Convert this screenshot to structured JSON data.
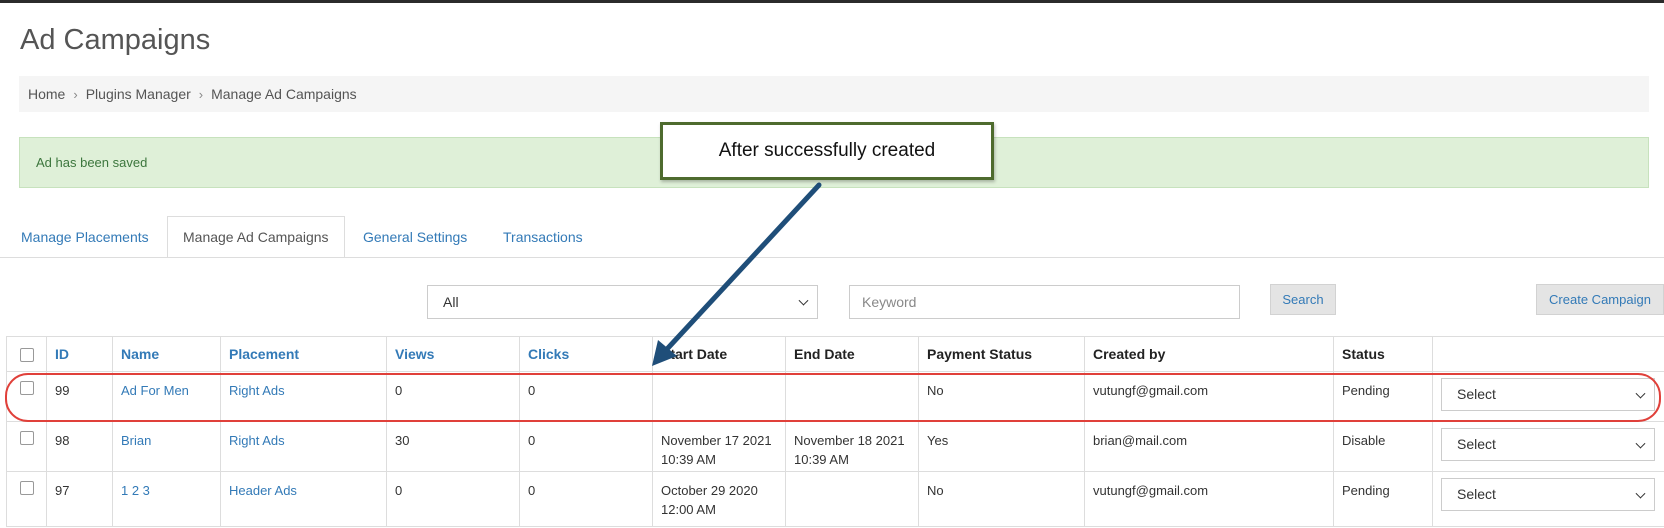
{
  "page": {
    "title": "Ad Campaigns"
  },
  "breadcrumb": {
    "items": [
      "Home",
      "Plugins Manager",
      "Manage Ad Campaigns"
    ],
    "separator": "›"
  },
  "alert": {
    "message": "Ad has been saved"
  },
  "tabs": [
    "Manage Placements",
    "Manage Ad Campaigns",
    "General Settings",
    "Transactions"
  ],
  "active_tab": "Manage Ad Campaigns",
  "filters": {
    "type_value": "All",
    "keyword_placeholder": "Keyword",
    "search_label": "Search",
    "create_label": "Create Campaign"
  },
  "table": {
    "headers": [
      "ID",
      "Name",
      "Placement",
      "Views",
      "Clicks",
      "Start Date",
      "End Date",
      "Payment Status",
      "Created by",
      "Status",
      ""
    ],
    "rows": [
      {
        "id": "99",
        "name": "Ad For Men",
        "placement": "Right Ads",
        "views": "0",
        "clicks": "0",
        "start_date": "",
        "start_time": "",
        "end_date": "",
        "end_time": "",
        "payment": "No",
        "created_by": "vutungf@gmail.com",
        "status": "Pending",
        "action": "Select"
      },
      {
        "id": "98",
        "name": "Brian",
        "placement": "Right Ads",
        "views": "30",
        "clicks": "0",
        "start_date": "November 17 2021",
        "start_time": "10:39 AM",
        "end_date": "November 18 2021",
        "end_time": "10:39 AM",
        "payment": "Yes",
        "created_by": "brian@mail.com",
        "status": "Disable",
        "action": "Select"
      },
      {
        "id": "97",
        "name": "1 2 3",
        "placement": "Header Ads",
        "views": "0",
        "clicks": "0",
        "start_date": "October 29 2020",
        "start_time": "12:00 AM",
        "end_date": "",
        "end_time": "",
        "payment": "No",
        "created_by": "vutungf@gmail.com",
        "status": "Pending",
        "action": "Select"
      }
    ]
  },
  "annotation": {
    "callout_text": "After successfully created",
    "arrow_color": "#1f4e79",
    "highlight_color": "#e0403a",
    "callout_border": "#4e6b2e"
  },
  "colors": {
    "link": "#337ab7",
    "alert_bg": "#dff0d8",
    "alert_text": "#3c763d"
  }
}
